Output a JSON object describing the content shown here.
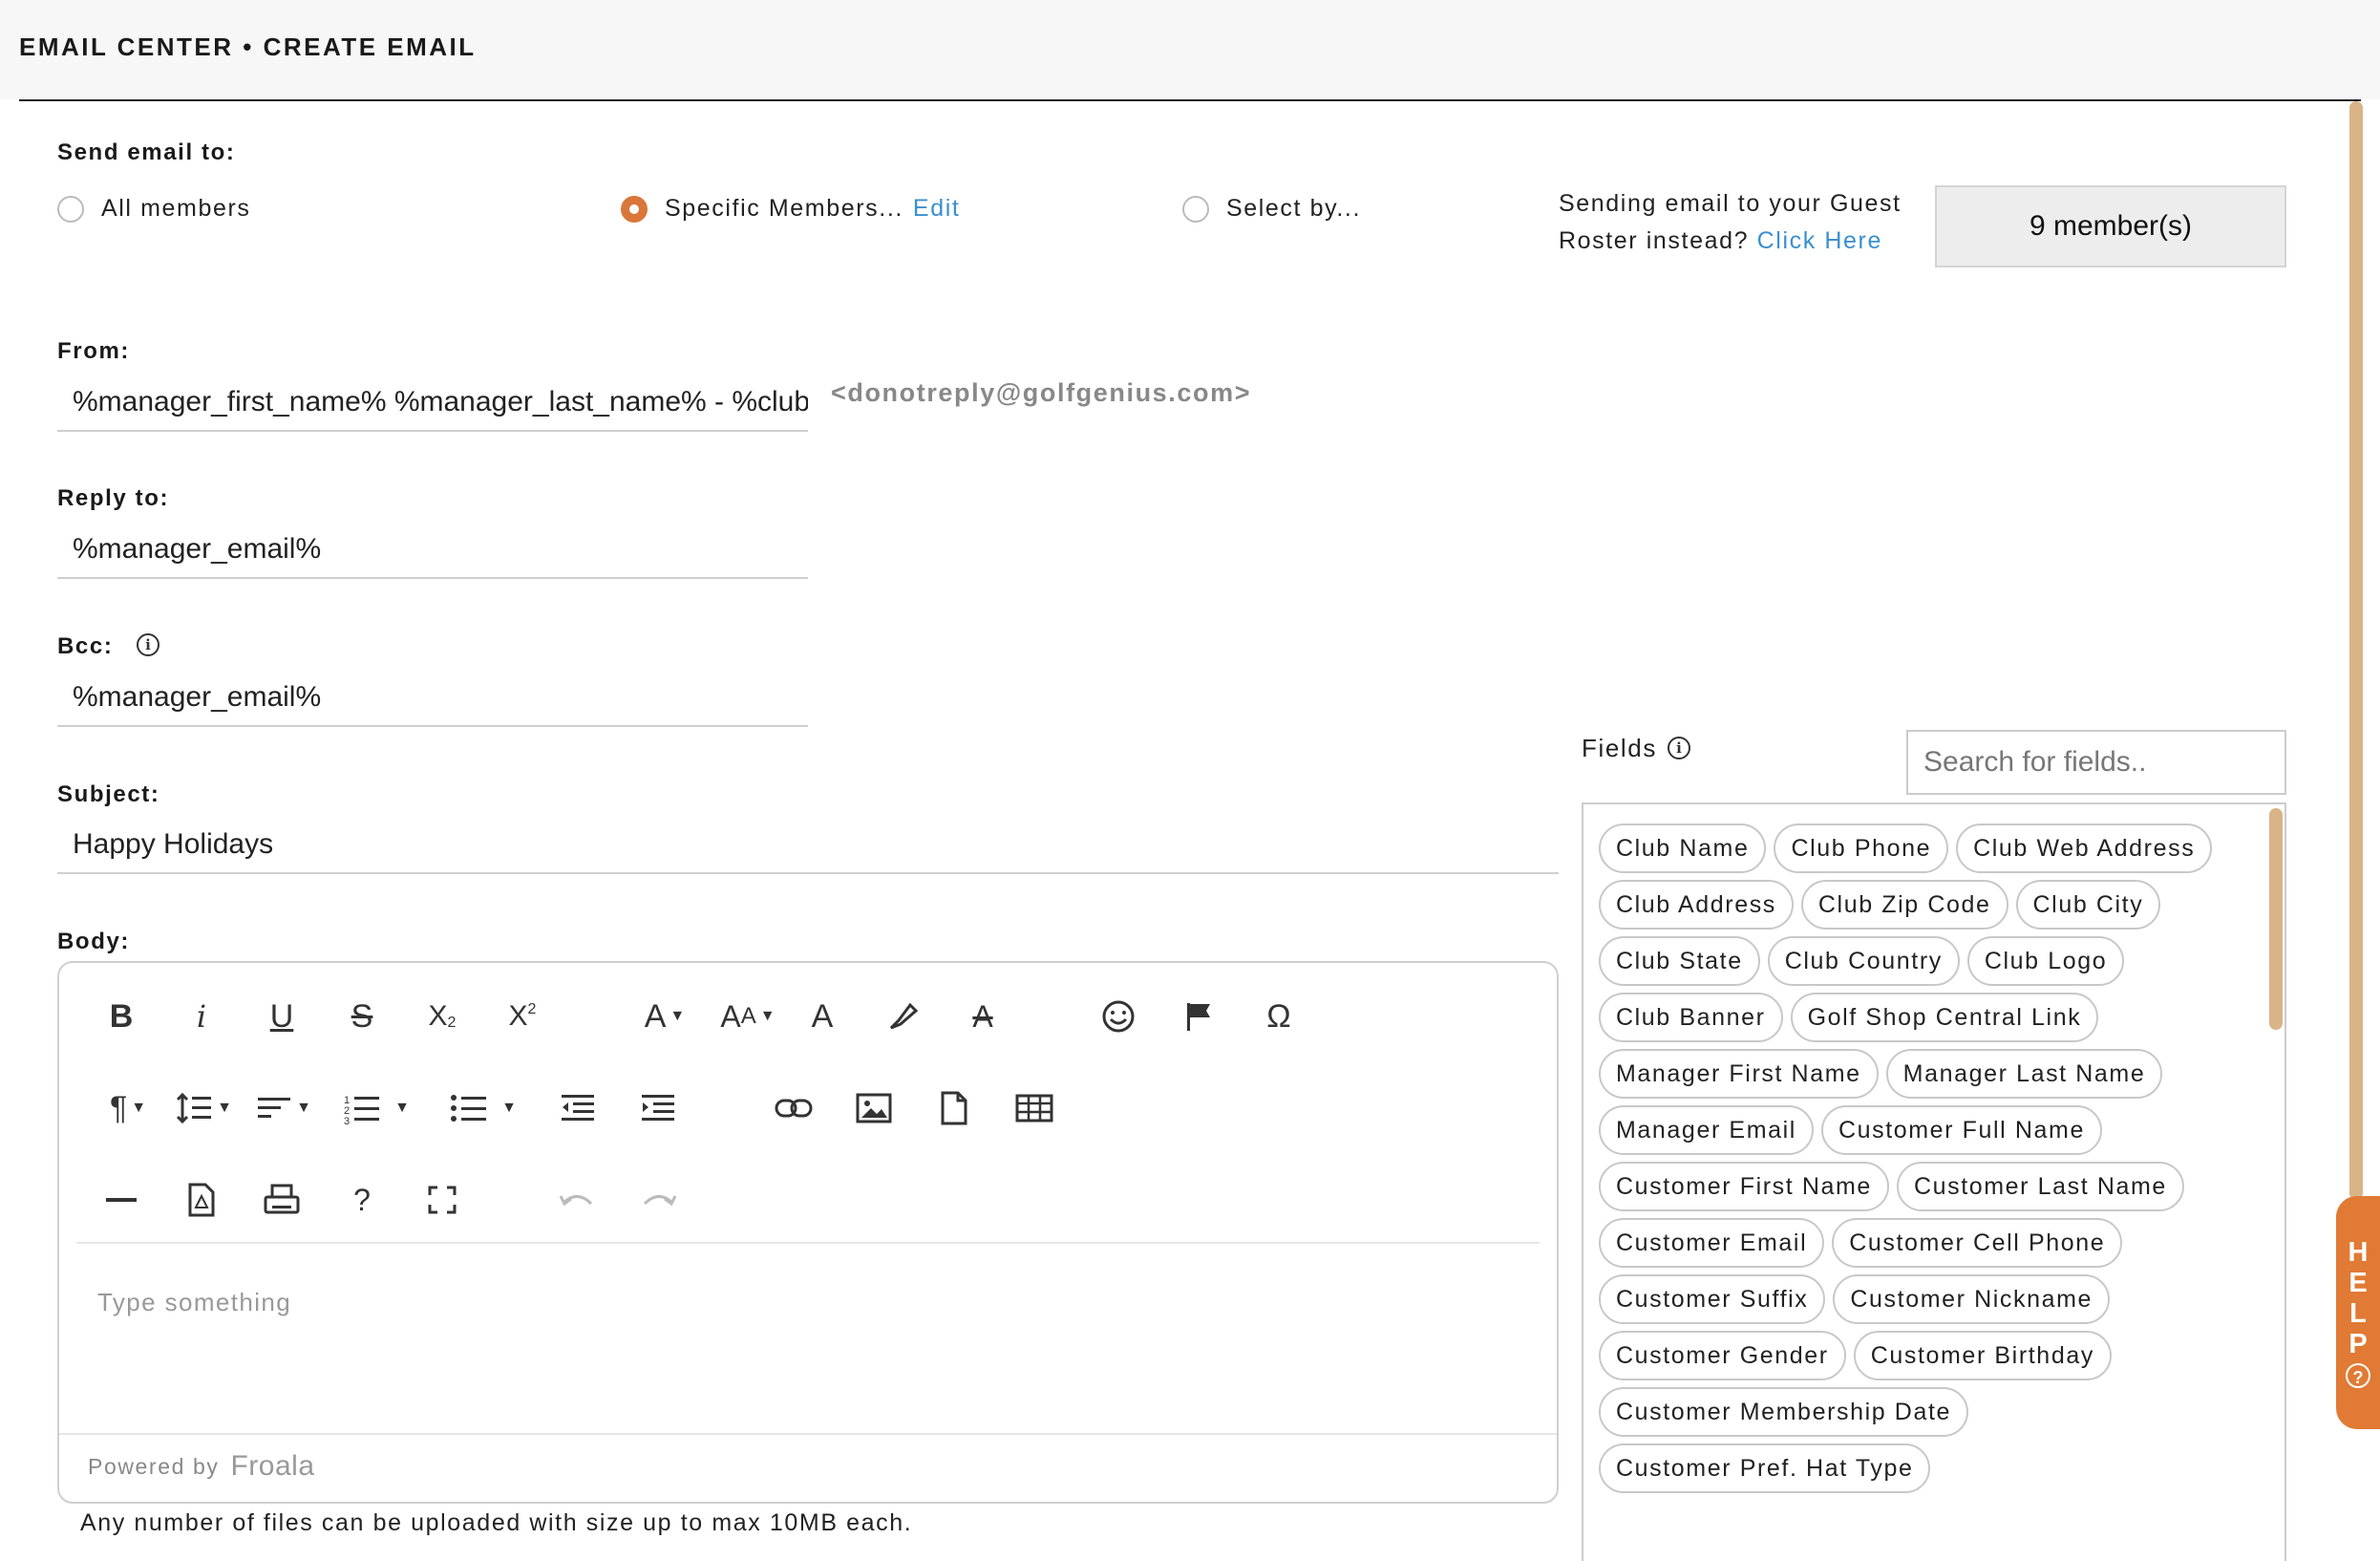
{
  "header": {
    "title": "EMAIL CENTER • CREATE EMAIL"
  },
  "send_to": {
    "label": "Send email to:",
    "options": [
      {
        "label": "All members",
        "checked": false
      },
      {
        "label": "Specific Members...",
        "checked": true,
        "link": "Edit"
      },
      {
        "label": "Select by...",
        "checked": false
      }
    ],
    "guest_note": "Sending email to your Guest Roster instead?",
    "guest_link": "Click Here",
    "member_count": "9 member(s)"
  },
  "from": {
    "label": "From:",
    "value": "%manager_first_name% %manager_last_name% - %club_name%",
    "email": "<donotreply@golfgenius.com>"
  },
  "reply_to": {
    "label": "Reply to:",
    "value": "%manager_email%"
  },
  "bcc": {
    "label": "Bcc:",
    "value": "%manager_email%"
  },
  "subject": {
    "label": "Subject:",
    "value": "Happy Holidays"
  },
  "body": {
    "label": "Body:",
    "placeholder": "Type something",
    "powered_by": "Powered by",
    "brand": "Froala",
    "toolbar_icons": [
      "bold-icon",
      "italic-icon",
      "underline-icon",
      "strikethrough-icon",
      "subscript-icon",
      "superscript-icon",
      "font-family-icon",
      "font-size-icon",
      "text-color-icon",
      "background-color-icon",
      "clear-formatting-icon",
      "emoticons-icon",
      "flag-icon",
      "special-characters-icon",
      "paragraph-format-icon",
      "line-height-icon",
      "align-icon",
      "ordered-list-icon",
      "unordered-list-icon",
      "outdent-icon",
      "indent-icon",
      "insert-link-icon",
      "insert-image-icon",
      "insert-file-icon",
      "insert-table-icon",
      "horizontal-line-icon",
      "pdf-icon",
      "print-icon",
      "help-icon",
      "fullscreen-icon",
      "undo-icon",
      "redo-icon"
    ]
  },
  "upload_note": "Any number of files can be uploaded with size up to max 10MB each.",
  "fields": {
    "label": "Fields",
    "search_placeholder": "Search for fields..",
    "chips": [
      "Club Name",
      "Club Phone",
      "Club Web Address",
      "Club Address",
      "Club Zip Code",
      "Club City",
      "Club State",
      "Club Country",
      "Club Logo",
      "Club Banner",
      "Golf Shop Central Link",
      "Manager First Name",
      "Manager Last Name",
      "Manager Email",
      "Customer Full Name",
      "Customer First Name",
      "Customer Last Name",
      "Customer Email",
      "Customer Cell Phone",
      "Customer Suffix",
      "Customer Nickname",
      "Customer Gender",
      "Customer Birthday",
      "Customer Membership Date",
      "Customer Pref. Hat Type"
    ]
  },
  "help_tab": {
    "letters": [
      "H",
      "E",
      "L",
      "P"
    ],
    "icon": "question-icon"
  },
  "colors": {
    "accent": "#e07a34",
    "link": "#3a8fd0",
    "scrollbar": "#d9b486"
  }
}
